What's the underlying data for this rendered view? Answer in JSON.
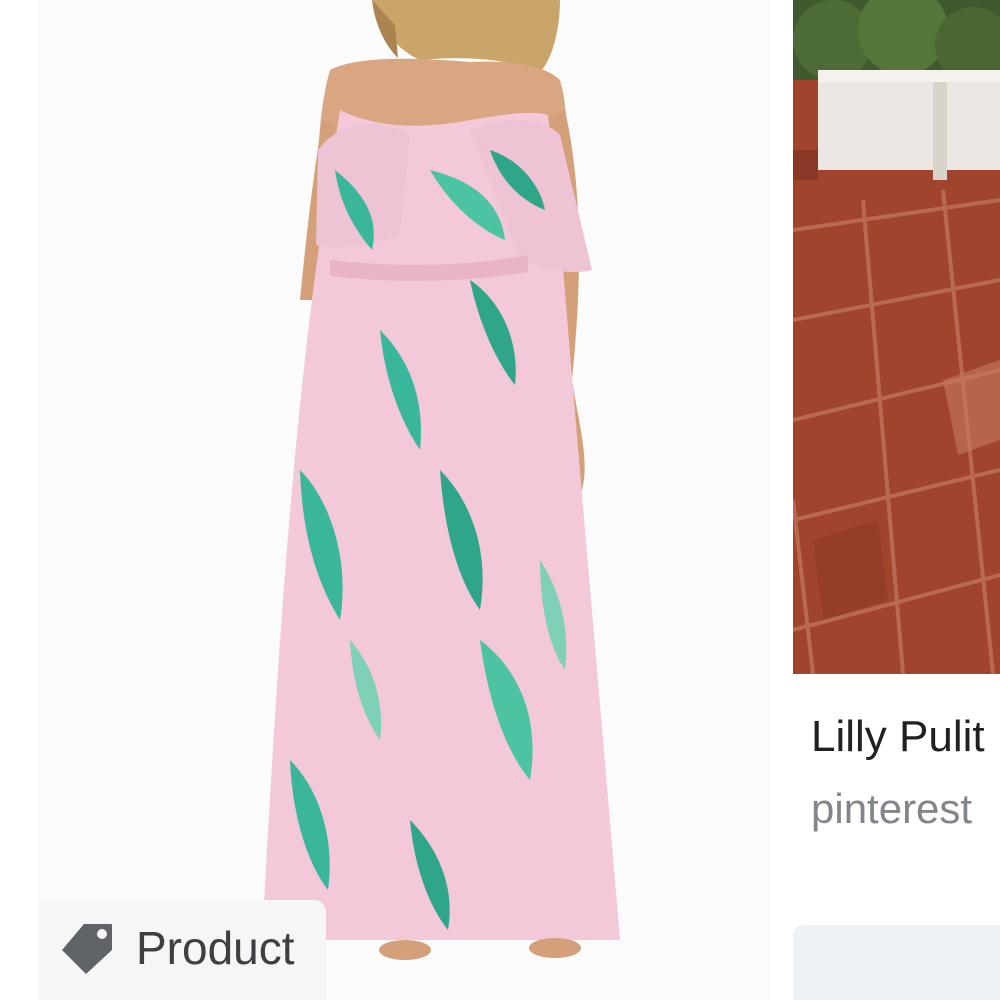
{
  "results": [
    {
      "image_alt": "model wearing a pink maxi dress with green tropical leaf print and cold-shoulder ruffle sleeves",
      "badge": {
        "icon": "tag-icon",
        "label": "Product"
      }
    },
    {
      "image_alt": "terracotta tiled patio with white planter box",
      "title": "Lilly Pulit",
      "source": "pinterest"
    }
  ],
  "colors": {
    "dress_pink": "#f3c9d9",
    "leaf_green": "#3ab79a",
    "tile_red": "#a1442d",
    "title_text": "#202124",
    "source_text": "#80868b"
  }
}
